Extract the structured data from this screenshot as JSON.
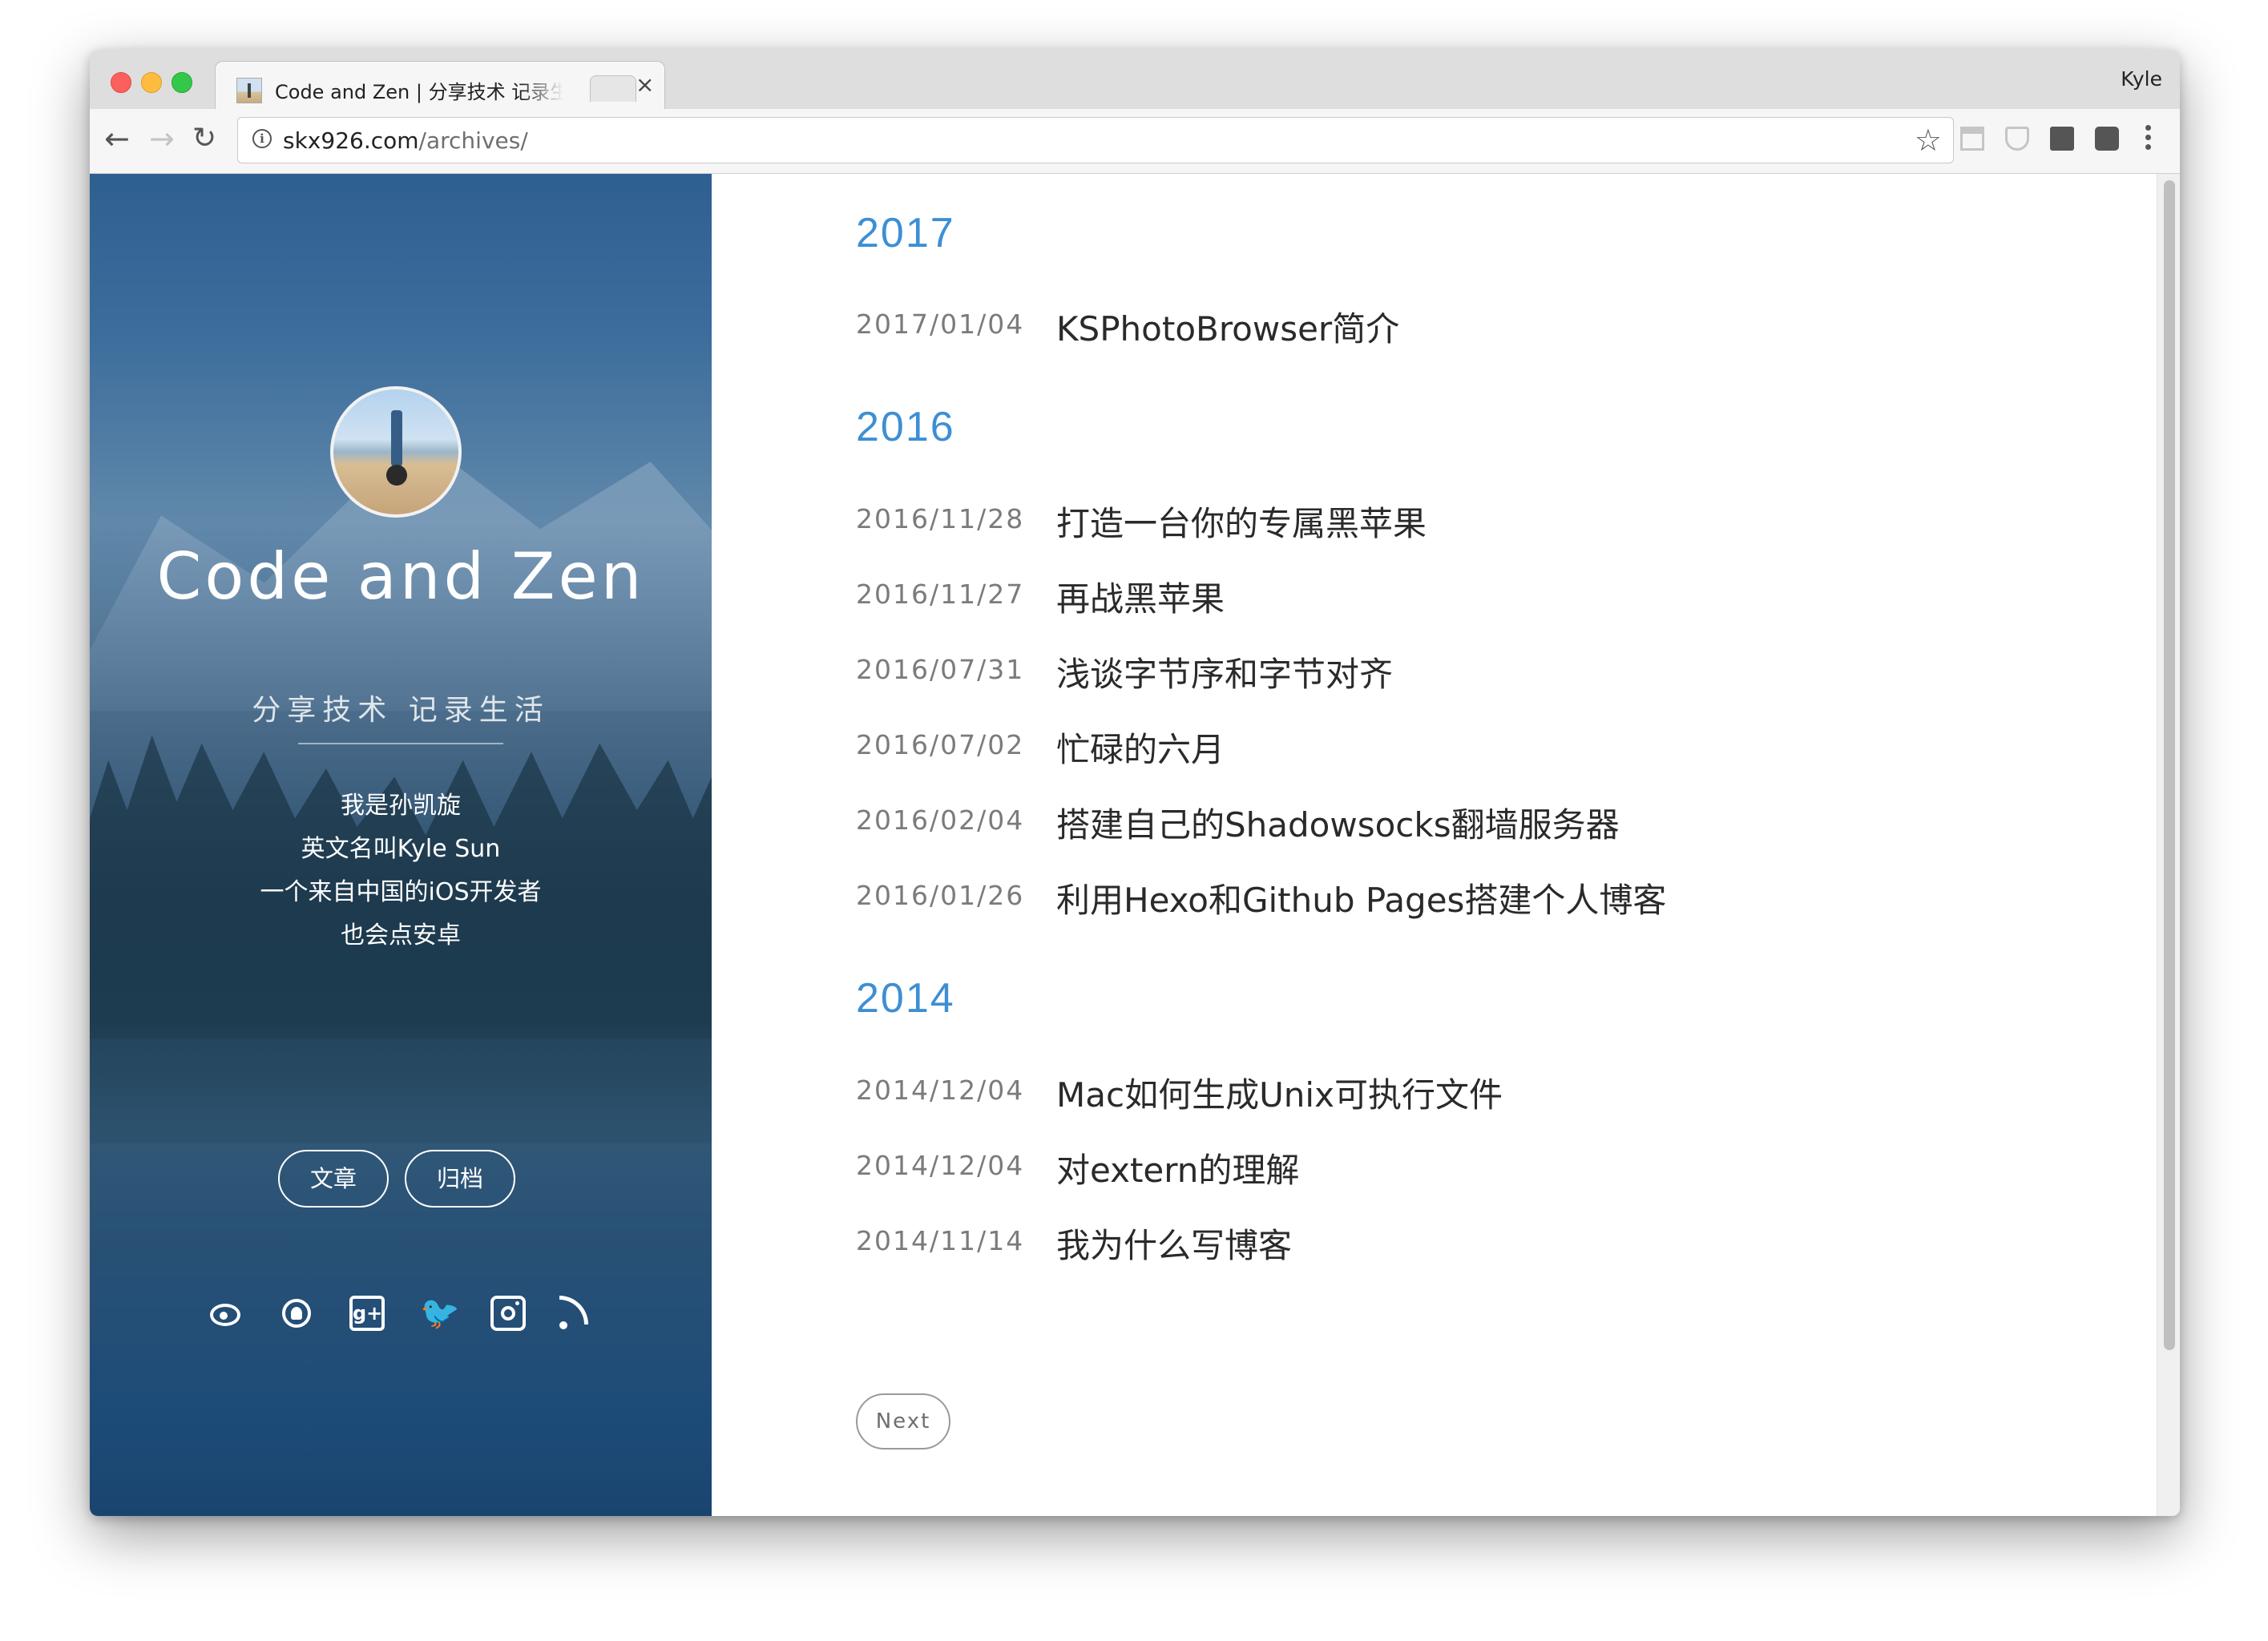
{
  "browser": {
    "tab_title": "Code and Zen | 分享技术 记录生活",
    "tab_close": "×",
    "profile_name": "Kyle",
    "url_host": "skx926.com",
    "url_path": "/archives/",
    "nav": {
      "back": "←",
      "forward": "→",
      "reload": "↻"
    },
    "star": "☆",
    "info": "i"
  },
  "sidebar": {
    "title": "Code and Zen",
    "subtitle": "分享技术 记录生活",
    "bio": [
      "我是孙凯旋",
      "英文名叫Kyle Sun",
      "一个来自中国的iOS开发者",
      "也会点安卓"
    ],
    "buttons": {
      "posts": "文章",
      "archives": "归档"
    },
    "social_icons": [
      "weibo-icon",
      "github-icon",
      "google-plus-icon",
      "twitter-icon",
      "instagram-icon",
      "rss-icon"
    ],
    "gplus_glyph": "g+",
    "twitter_glyph": "🐦"
  },
  "archives": [
    {
      "year": "2017",
      "posts": [
        {
          "date": "2017/01/04",
          "title": "KSPhotoBrowser简介"
        }
      ]
    },
    {
      "year": "2016",
      "posts": [
        {
          "date": "2016/11/28",
          "title": "打造一台你的专属黑苹果"
        },
        {
          "date": "2016/11/27",
          "title": "再战黑苹果"
        },
        {
          "date": "2016/07/31",
          "title": "浅谈字节序和字节对齐"
        },
        {
          "date": "2016/07/02",
          "title": "忙碌的六月"
        },
        {
          "date": "2016/02/04",
          "title": "搭建自己的Shadowsocks翻墙服务器"
        },
        {
          "date": "2016/01/26",
          "title": "利用Hexo和Github Pages搭建个人博客"
        }
      ]
    },
    {
      "year": "2014",
      "posts": [
        {
          "date": "2014/12/04",
          "title": "Mac如何生成Unix可执行文件"
        },
        {
          "date": "2014/12/04",
          "title": "对extern的理解"
        },
        {
          "date": "2014/11/14",
          "title": "我为什么写博客"
        }
      ]
    }
  ],
  "pagination": {
    "next_label": "Next"
  },
  "colors": {
    "year_accent": "#3d8fd4",
    "sidebar_blue": "#2e5f91"
  }
}
